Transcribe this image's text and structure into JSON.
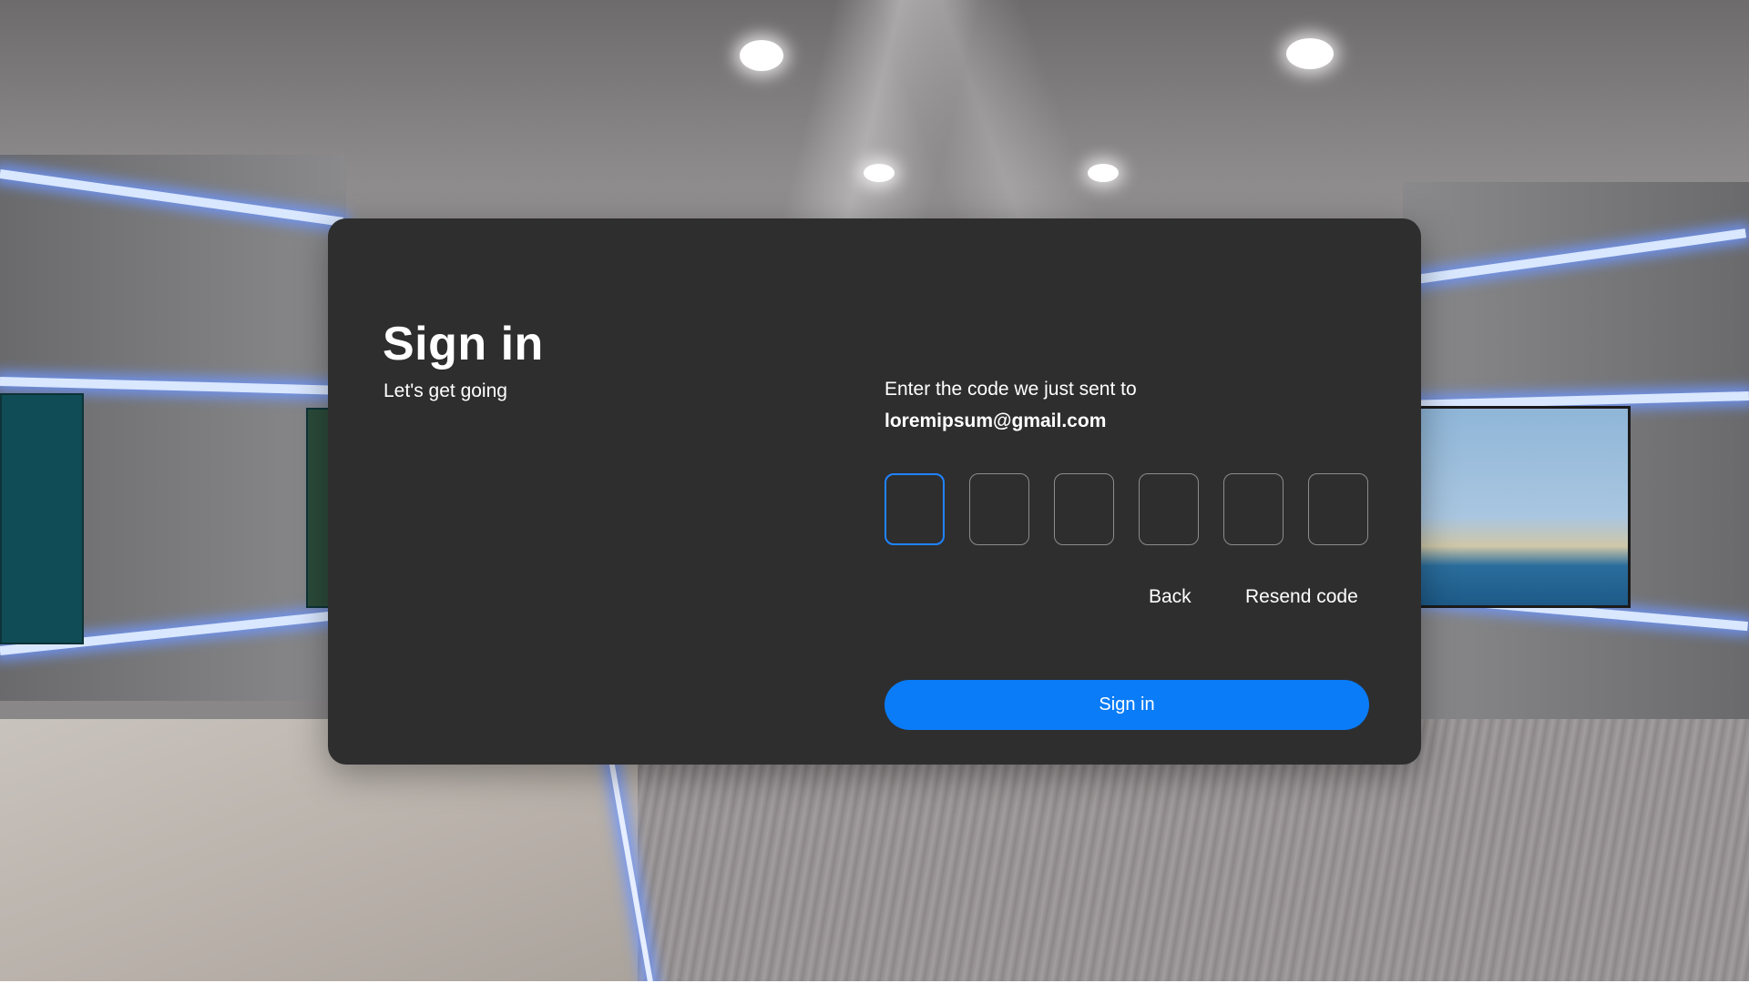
{
  "signin": {
    "title": "Sign in",
    "subtitle": "Let's get going",
    "instruction": "Enter the code we just sent to",
    "email": "loremipsum@gmail.com",
    "code_digits": [
      "",
      "",
      "",
      "",
      "",
      ""
    ],
    "active_digit_index": 0,
    "back_label": "Back",
    "resend_label": "Resend code",
    "submit_label": "Sign in"
  },
  "colors": {
    "panel_background": "#2e2e2f",
    "accent": "#0a7cf7",
    "active_border": "#1f84ff",
    "text": "#ffffff"
  }
}
